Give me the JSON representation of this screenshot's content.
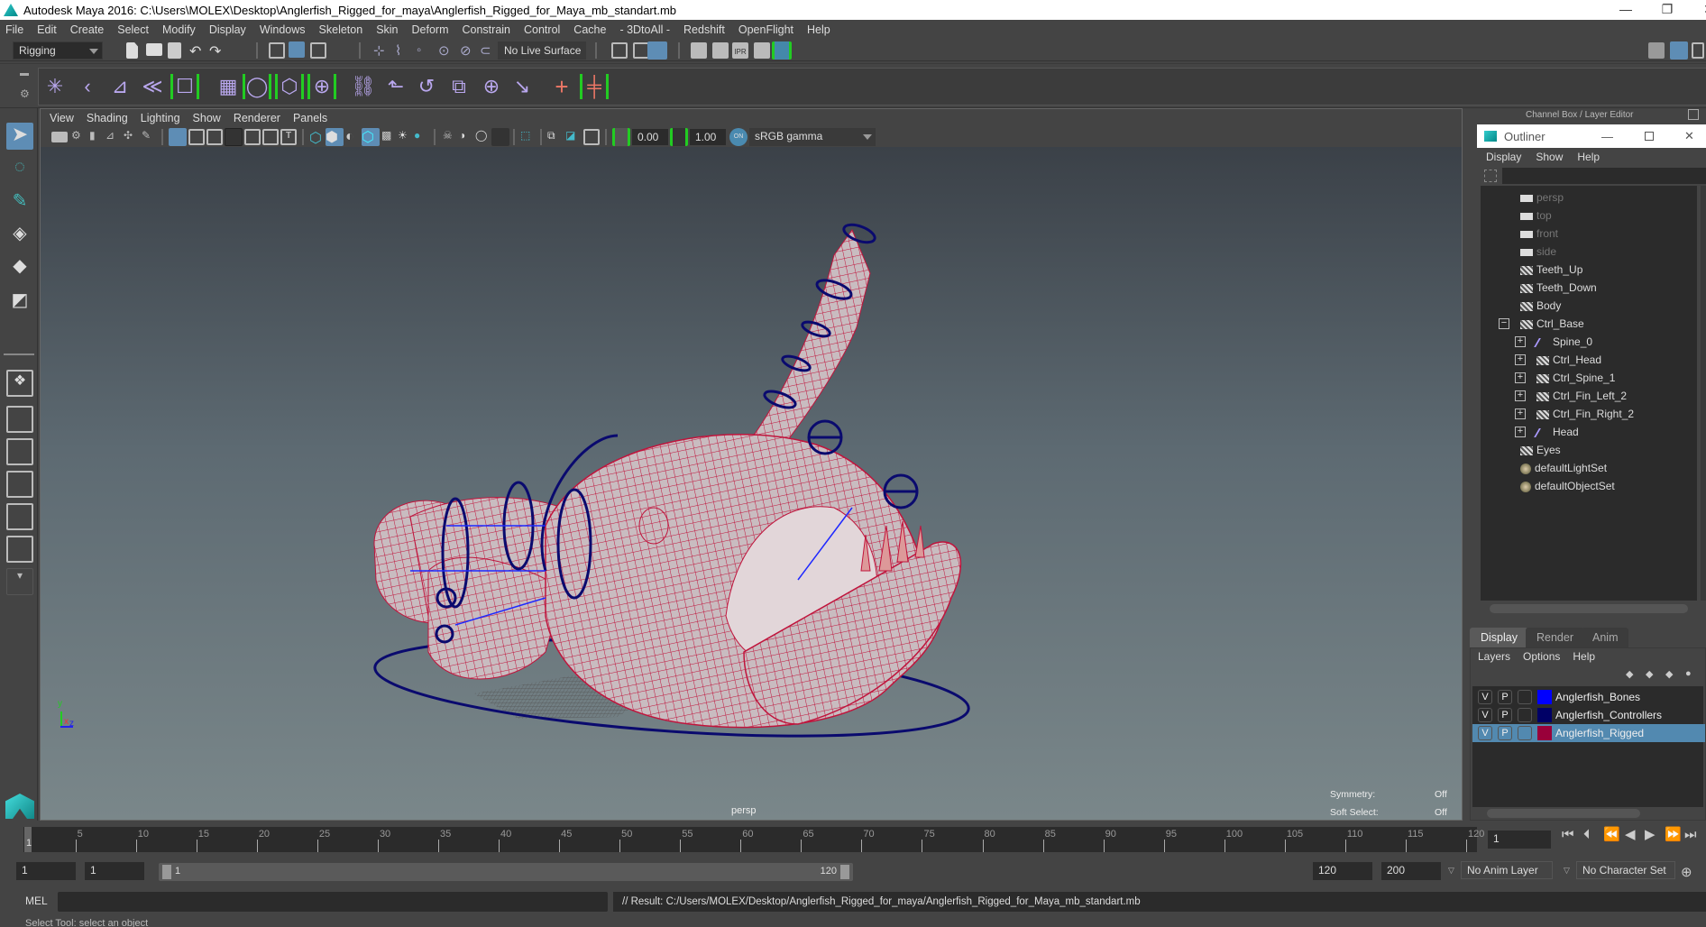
{
  "window": {
    "title": "Autodesk Maya 2016: C:\\Users\\MOLEX\\Desktop\\Anglerfish_Rigged_for_maya\\Anglerfish_Rigged_for_Maya_mb_standart.mb",
    "minimize": "—",
    "restore": "❐",
    "close": "✕"
  },
  "menubar": [
    "File",
    "Edit",
    "Create",
    "Select",
    "Modify",
    "Display",
    "Windows",
    "Skeleton",
    "Skin",
    "Deform",
    "Constrain",
    "Control",
    "Cache",
    "- 3DtoAll -",
    "Redshift",
    "OpenFlight",
    "Help"
  ],
  "statusline": {
    "menuset": "Rigging",
    "live_surface": "No Live Surface"
  },
  "viewport": {
    "menu": [
      "View",
      "Shading",
      "Lighting",
      "Show",
      "Renderer",
      "Panels"
    ],
    "exposure": "0.00",
    "gamma": "1.00",
    "colorspace_toggle": "ON",
    "colorspace": "sRGB gamma",
    "camera_label": "persp",
    "hud": [
      {
        "label": "Symmetry:",
        "value": "Off"
      },
      {
        "label": "Soft Select:",
        "value": "Off"
      }
    ],
    "axis": {
      "y": "y",
      "x": "x",
      "z": "z"
    },
    "colors": {
      "wireframe": "#c0143c",
      "controllers": "#0a0a6e",
      "bones": "#1e28ff",
      "mesh": "#c9bcc0"
    }
  },
  "channelbox": {
    "header": "Channel Box / Layer Editor"
  },
  "outliner": {
    "title": "Outliner",
    "menu": [
      "Display",
      "Show",
      "Help"
    ],
    "items": [
      {
        "name": "persp",
        "type": "camera",
        "depth": 0,
        "expander": ""
      },
      {
        "name": "top",
        "type": "camera",
        "depth": 0,
        "expander": ""
      },
      {
        "name": "front",
        "type": "camera",
        "depth": 0,
        "expander": ""
      },
      {
        "name": "side",
        "type": "camera",
        "depth": 0,
        "expander": ""
      },
      {
        "name": "Teeth_Up",
        "type": "mesh",
        "depth": 0,
        "expander": ""
      },
      {
        "name": "Teeth_Down",
        "type": "mesh",
        "depth": 0,
        "expander": ""
      },
      {
        "name": "Body",
        "type": "mesh",
        "depth": 0,
        "expander": ""
      },
      {
        "name": "Ctrl_Base",
        "type": "mesh",
        "depth": 0,
        "expander": "−"
      },
      {
        "name": "Spine_0",
        "type": "joint",
        "depth": 1,
        "expander": "+"
      },
      {
        "name": "Ctrl_Head",
        "type": "mesh",
        "depth": 1,
        "expander": "+"
      },
      {
        "name": "Ctrl_Spine_1",
        "type": "mesh",
        "depth": 1,
        "expander": "+"
      },
      {
        "name": "Ctrl_Fin_Left_2",
        "type": "mesh",
        "depth": 1,
        "expander": "+"
      },
      {
        "name": "Ctrl_Fin_Right_2",
        "type": "mesh",
        "depth": 1,
        "expander": "+"
      },
      {
        "name": "Head",
        "type": "joint",
        "depth": 1,
        "expander": "+"
      },
      {
        "name": "Eyes",
        "type": "mesh",
        "depth": 0,
        "expander": ""
      },
      {
        "name": "defaultLightSet",
        "type": "set",
        "depth": 0,
        "expander": ""
      },
      {
        "name": "defaultObjectSet",
        "type": "set",
        "depth": 0,
        "expander": ""
      }
    ]
  },
  "layer_editor": {
    "tabs": [
      "Display",
      "Render",
      "Anim"
    ],
    "active_tab": "Display",
    "menu": [
      "Layers",
      "Options",
      "Help"
    ],
    "layers": [
      {
        "v": "V",
        "p": "P",
        "name": "Anglerfish_Bones",
        "color": "#0000ff",
        "selected": false
      },
      {
        "v": "V",
        "p": "P",
        "name": "Anglerfish_Controllers",
        "color": "#000066",
        "selected": false
      },
      {
        "v": "V",
        "p": "P",
        "name": "Anglerfish_Rigged",
        "color": "#99003a",
        "selected": true
      }
    ]
  },
  "timeline": {
    "labels": [
      "5",
      "10",
      "15",
      "20",
      "25",
      "30",
      "35",
      "40",
      "45",
      "50",
      "55",
      "60",
      "65",
      "70",
      "75",
      "80",
      "85",
      "90",
      "95",
      "100",
      "105",
      "110",
      "115",
      "120"
    ],
    "current_frame": "1",
    "range_min": 1,
    "range_max": 120,
    "current_frame_field": "1"
  },
  "range": {
    "start": "1",
    "playback_start": "1",
    "slider_start": "1",
    "slider_end": "120",
    "playback_end": "120",
    "end": "200",
    "anim_layer": "No Anim Layer",
    "character_set": "No Character Set"
  },
  "command": {
    "lang": "MEL",
    "input": "",
    "result": "// Result: C:/Users/MOLEX/Desktop/Anglerfish_Rigged_for_maya/Anglerfish_Rigged_for_Maya_mb_standart.mb"
  },
  "helpline": "Select Tool: select an object"
}
